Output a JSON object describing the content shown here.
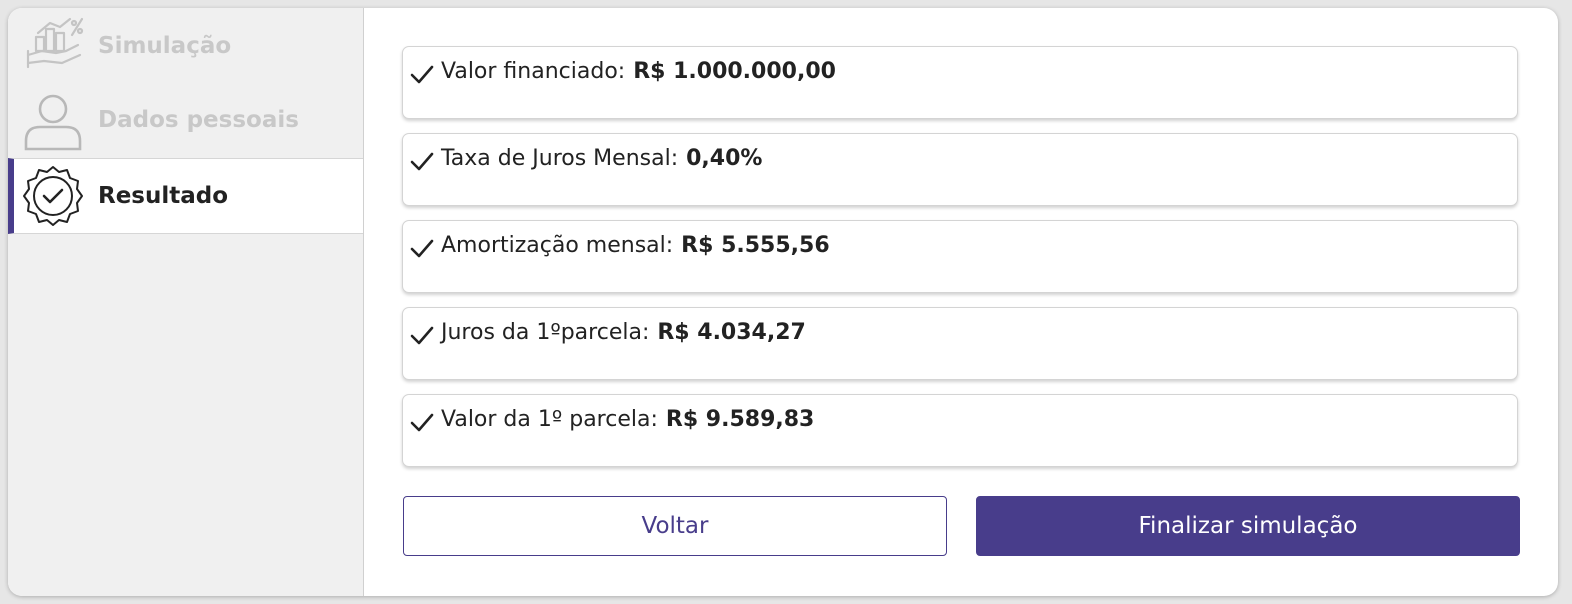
{
  "sidebar": {
    "steps": [
      {
        "label": "Simulação",
        "state": "done",
        "icon": "chart-hand-icon"
      },
      {
        "label": "Dados pessoais",
        "state": "done",
        "icon": "user-icon"
      },
      {
        "label": "Resultado",
        "state": "active",
        "icon": "badge-check-icon"
      }
    ]
  },
  "results": [
    {
      "label": "Valor financiado:",
      "value": "R$ 1.000.000,00"
    },
    {
      "label": "Taxa de Juros Mensal:",
      "value": "0,40%"
    },
    {
      "label": "Amortização mensal:",
      "value": "R$ 5.555,56"
    },
    {
      "label": "Juros da 1ºparcela:",
      "value": "R$ 4.034,27"
    },
    {
      "label": "Valor da 1º parcela:",
      "value": "R$ 9.589,83"
    }
  ],
  "actions": {
    "back_label": "Voltar",
    "finish_label": "Finalizar simulação"
  },
  "colors": {
    "accent": "#483d8b",
    "muted": "#c8c8c8",
    "sidebar_bg": "#f0f0f0"
  }
}
